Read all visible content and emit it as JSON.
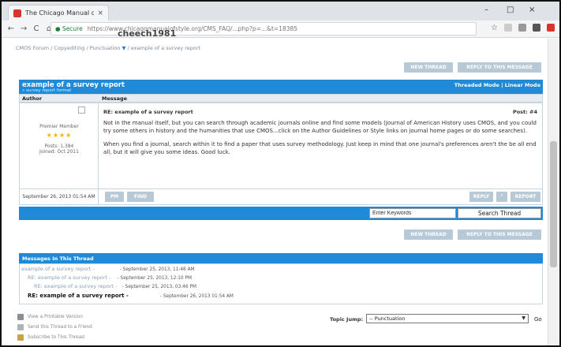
{
  "browser": {
    "tab_title": "The Chicago Manual of S",
    "tab_close": "×",
    "win_minimize": "–",
    "win_restore": "□",
    "win_close": "×",
    "nav_back": "←",
    "nav_forward": "→",
    "nav_reload": "C",
    "nav_home": "⌂",
    "secure_label": "● Secure",
    "url": "https://www.chicagomanualofstyle.org/CMS_FAQ/...php?p=...&t=18385",
    "overlay_user": "cheech1981",
    "star": "☆"
  },
  "breadcrumb": {
    "text": "CMOS Forum / Copyediting / Punctuation",
    "arrow": "▼",
    "current": "/ example of a survey report"
  },
  "top_buttons": {
    "new_thread": "NEW THREAD",
    "reply": "REPLY TO THIS MESSAGE"
  },
  "thread": {
    "title": "example of a survey report",
    "subtitle": "» survey report format",
    "modes": "Threaded Mode | Linear Mode"
  },
  "columns": {
    "author": "Author",
    "message": "Message"
  },
  "post": {
    "rank": "Premier Member",
    "stars": "★★★★",
    "posts": "Posts: 1,384",
    "joined": "Joined: Oct 2011",
    "title": "RE: example of a survey report",
    "number": "Post: #4",
    "para1": "Not in the manual itself, but you can search through academic journals online and find some models (Journal of American History uses CMOS, and you could try some others in history and the humanities that use CMOS...click on the Author Guidelines or Style links on journal home pages or do some searches).",
    "para2": "When you find a journal, search within it to find a paper that uses survey methodology. Just keep in mind that one journal's preferences aren't the be all end all, but it will give you some ideas. Good luck.",
    "date": "September 26, 2013 01:54 AM",
    "btn_pm": "PM",
    "btn_find": "FIND",
    "btn_reply": "REPLY",
    "btn_quote": "\"",
    "btn_report": "REPORT"
  },
  "search": {
    "placeholder": "Enter Keywords",
    "button": "Search Thread"
  },
  "bottom_buttons": {
    "new_thread": "NEW THREAD",
    "reply": "REPLY TO THIS MESSAGE"
  },
  "messages": {
    "header": "Messages In This Thread",
    "items": [
      {
        "title": "example of a survey report -",
        "date": "- September 25, 2013, 11:48 AM"
      },
      {
        "title": "RE: example of a survey report -",
        "date": "- September 25, 2013, 12:10 PM"
      },
      {
        "title": "RE: example of a survey report -",
        "date": "- September 25, 2013, 03:46 PM"
      },
      {
        "title": "RE: example of a survey report -",
        "date": "- September 26, 2013 01:54 AM"
      }
    ]
  },
  "tools": {
    "printable": "View a Printable Version",
    "send": "Send this Thread to a Friend",
    "subscribe": "Subscribe to This Thread"
  },
  "topic_jump": {
    "label": "Topic Jump:",
    "selected": "-- Punctuation",
    "go": "Go"
  },
  "colors": {
    "accent": "#1f8bd8",
    "button": "#b7c9d6",
    "favicon": "#d9342b"
  }
}
